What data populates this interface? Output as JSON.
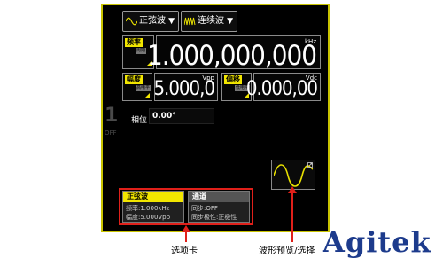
{
  "toolbar": {
    "waveform_select": "正弦波",
    "mode_select": "连续波"
  },
  "frequency": {
    "tag": "频率",
    "subtag": "周期",
    "unit": "kHz",
    "value": "1.000,000,000"
  },
  "amplitude": {
    "tag": "幅度",
    "subtag": "高电平",
    "unit": "Vpp",
    "value": "5.000,0"
  },
  "offset": {
    "tag": "偏移",
    "subtag": "低电平",
    "unit": "Vdc",
    "value": "0.000,00"
  },
  "phase": {
    "label": "相位",
    "value": "0.00°"
  },
  "channel": {
    "number": "1",
    "state": "OFF"
  },
  "tabs": [
    {
      "title": "正弦波",
      "lines": [
        "频率:1.000kHz",
        "幅度:5.000Vpp"
      ]
    },
    {
      "title": "通道",
      "lines": [
        "同步:OFF",
        "同步极性:正极性"
      ]
    }
  ],
  "annotations": {
    "tabs_caption": "选项卡",
    "preview_caption": "波形预览/选择"
  },
  "brand": {
    "logo_text": "Agitek"
  },
  "colors": {
    "highlight": "#f2e600",
    "frame": "#c8c300",
    "callout": "#e0201a",
    "wave": "#e8e000"
  }
}
